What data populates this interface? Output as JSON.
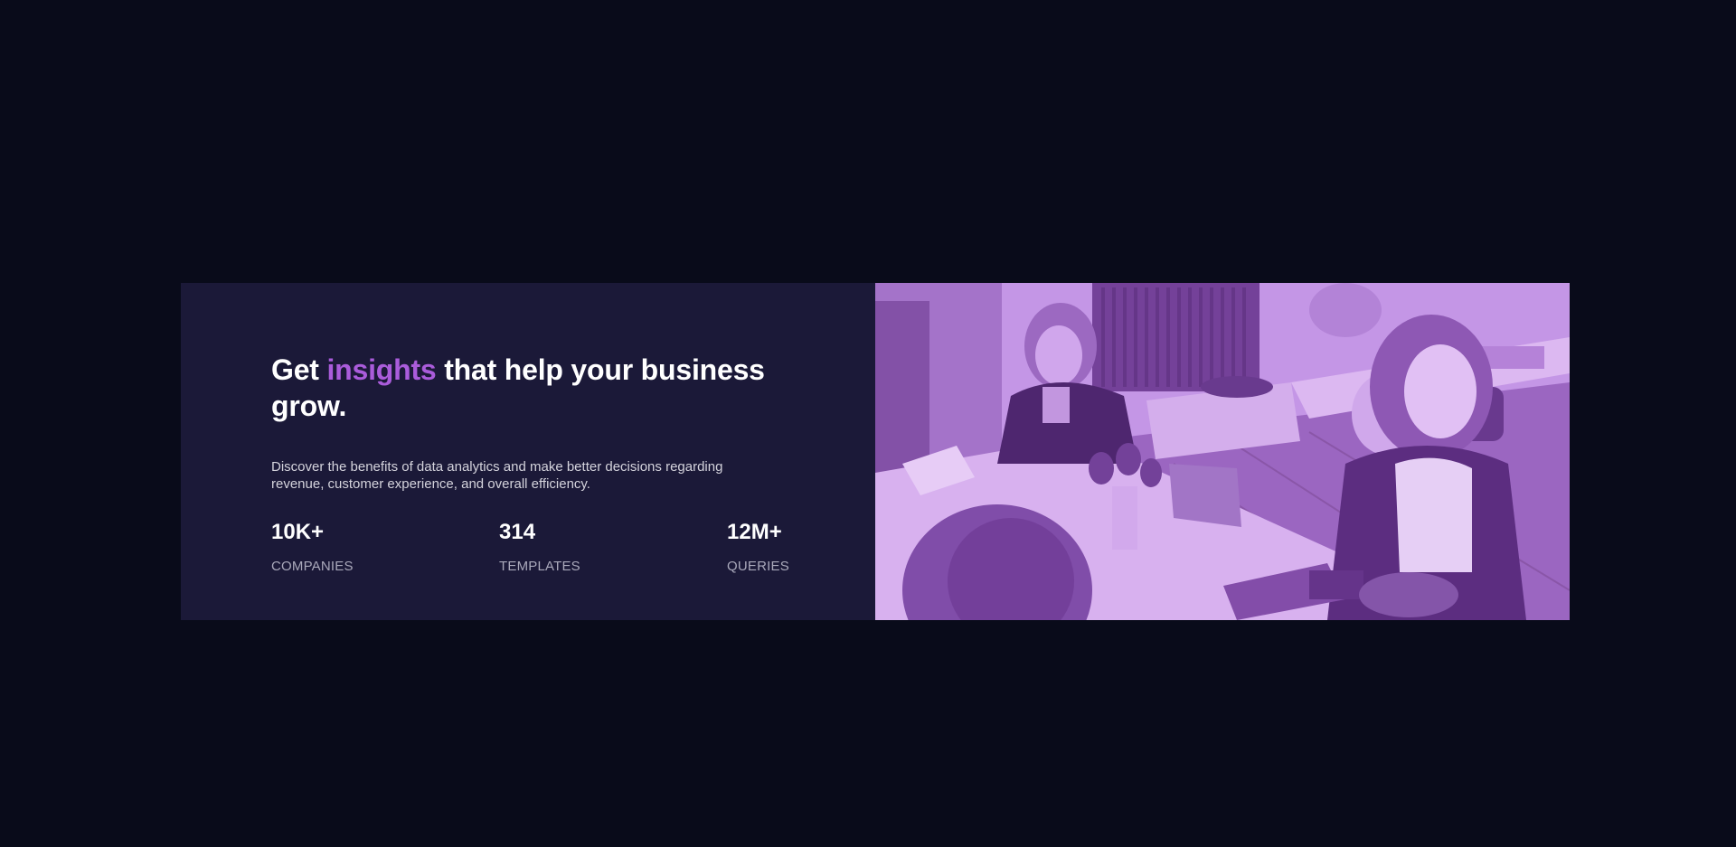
{
  "hero": {
    "headline_before": "Get ",
    "headline_accent": "insights",
    "headline_after": " that help your business grow.",
    "description": "Discover the benefits of data analytics and make better decisions regarding revenue, customer experience, and overall efficiency."
  },
  "stats": [
    {
      "value": "10K+",
      "label": "COMPANIES"
    },
    {
      "value": "314",
      "label": "TEMPLATES"
    },
    {
      "value": "12M+",
      "label": "QUERIES"
    }
  ],
  "image": {
    "subject": "office-meeting-photo",
    "overlay_color": "#aa5cdb"
  },
  "colors": {
    "page_background": "#090b1a",
    "card_background": "#1b1938",
    "accent": "#aa5cdb",
    "heading": "#ffffff",
    "body_text": "#d4d3dc",
    "stat_label": "#aaa9bb"
  }
}
